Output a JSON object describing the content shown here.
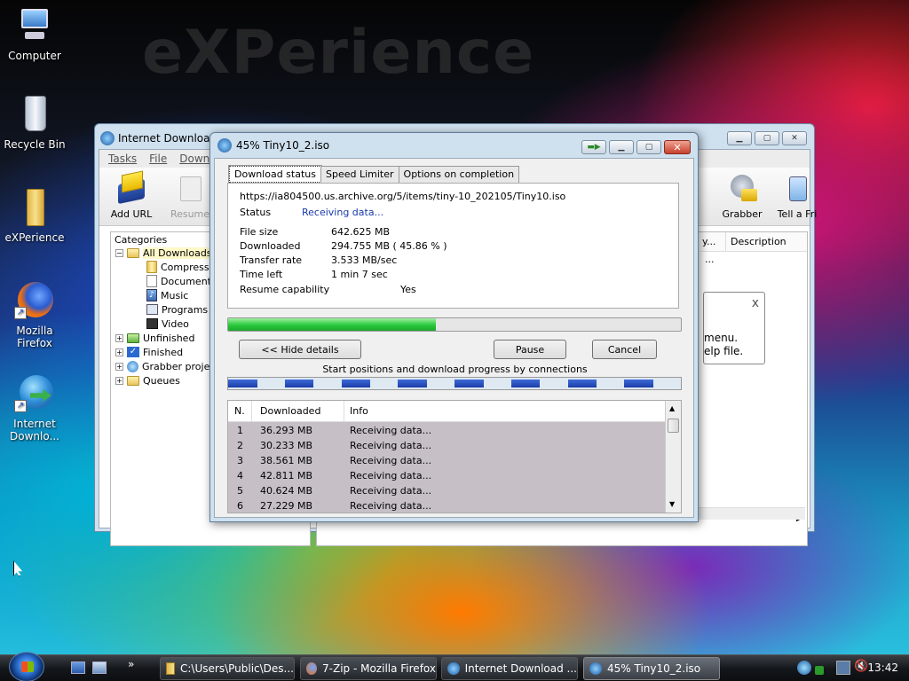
{
  "desktop": {
    "wallpaper_text": "eXPerience",
    "icons": [
      {
        "label": "Computer",
        "icon": "computer-icon"
      },
      {
        "label": "Recycle Bin",
        "icon": "recycle-bin-icon"
      },
      {
        "label": "eXPerience",
        "icon": "folder-icon"
      },
      {
        "label_line1": "Mozilla",
        "label_line2": "Firefox",
        "icon": "firefox-icon"
      },
      {
        "label_line1": "Internet",
        "label_line2": "Downlo...",
        "icon": "idm-icon"
      }
    ]
  },
  "main_window": {
    "title": "Internet Download",
    "menu": [
      "Tasks",
      "File",
      "Downlo"
    ],
    "toolbar": {
      "add_url": "Add URL",
      "resume": "Resume",
      "grabber": "Grabber",
      "tell_friend": "Tell a Fri"
    },
    "categories": {
      "header": "Categories",
      "items": [
        {
          "label": "All Downloads",
          "level": 0
        },
        {
          "label": "Compressed",
          "level": 1
        },
        {
          "label": "Documents",
          "level": 1
        },
        {
          "label": "Music",
          "level": 1
        },
        {
          "label": "Programs",
          "level": 1
        },
        {
          "label": "Video",
          "level": 1
        },
        {
          "label": "Unfinished",
          "level": 0
        },
        {
          "label": "Finished",
          "level": 0
        },
        {
          "label": "Grabber projec",
          "level": 0
        },
        {
          "label": "Queues",
          "level": 0
        }
      ]
    },
    "list_columns": {
      "partial": "y...",
      "description": "Description"
    },
    "list_partial_row": "...",
    "tooltip": {
      "close": "x",
      "line1": "menu.",
      "line2": "elp file."
    }
  },
  "dialog": {
    "title": "45% Tiny10_2.iso",
    "tabs": [
      "Download status",
      "Speed Limiter",
      "Options on completion"
    ],
    "url": "https://ia804500.us.archive.org/5/items/tiny-10_202105/Tiny10.iso",
    "status_label": "Status",
    "status_value": "Receiving data...",
    "file_size_label": "File size",
    "file_size_value": "642.625  MB",
    "downloaded_label": "Downloaded",
    "downloaded_value": "294.755  MB  ( 45.86 % )",
    "transfer_rate_label": "Transfer rate",
    "transfer_rate_value": "3.533  MB/sec",
    "time_left_label": "Time left",
    "time_left_value": "1 min 7 sec",
    "resume_label": "Resume capability",
    "resume_value": "Yes",
    "progress_percent": 45.86,
    "buttons": {
      "hide_details": "<< Hide details",
      "pause": "Pause",
      "cancel": "Cancel"
    },
    "connections_caption": "Start positions and download progress by connections",
    "connection_columns": {
      "n": "N.",
      "downloaded": "Downloaded",
      "info": "Info"
    },
    "connections": [
      {
        "n": "1",
        "downloaded": "36.293  MB",
        "info": "Receiving data..."
      },
      {
        "n": "2",
        "downloaded": "30.233  MB",
        "info": "Receiving data..."
      },
      {
        "n": "3",
        "downloaded": "38.561  MB",
        "info": "Receiving data..."
      },
      {
        "n": "4",
        "downloaded": "42.811  MB",
        "info": "Receiving data..."
      },
      {
        "n": "5",
        "downloaded": "40.624  MB",
        "info": "Receiving data..."
      },
      {
        "n": "6",
        "downloaded": "27.229  MB",
        "info": "Receiving data..."
      }
    ],
    "connection_fraction_per_segment": 0.51
  },
  "taskbar": {
    "quicklaunch_more": "»",
    "buttons": [
      {
        "label": "C:\\Users\\Public\\Des...",
        "icon": "folder-icon"
      },
      {
        "label": "7-Zip - Mozilla Firefox",
        "icon": "firefox-icon"
      },
      {
        "label": "Internet Download ...",
        "icon": "idm-icon"
      },
      {
        "label": "45% Tiny10_2.iso",
        "icon": "idm-icon",
        "active": true
      }
    ],
    "time": "13:42"
  }
}
